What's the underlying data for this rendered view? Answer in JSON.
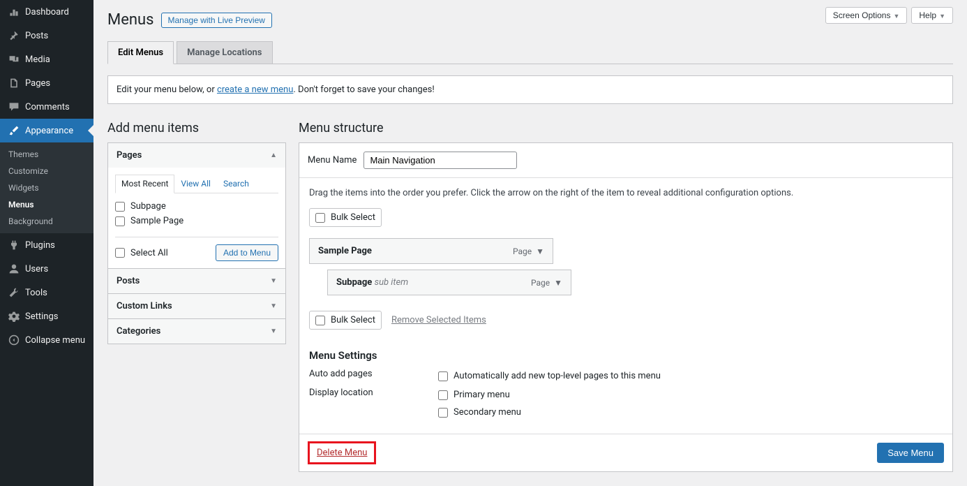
{
  "topbar": {
    "screen_options": "Screen Options",
    "help": "Help"
  },
  "page_title": "Menus",
  "manage_preview": "Manage with Live Preview",
  "sidebar": {
    "items": [
      {
        "label": "Dashboard"
      },
      {
        "label": "Posts"
      },
      {
        "label": "Media"
      },
      {
        "label": "Pages"
      },
      {
        "label": "Comments"
      },
      {
        "label": "Appearance"
      },
      {
        "label": "Plugins"
      },
      {
        "label": "Users"
      },
      {
        "label": "Tools"
      },
      {
        "label": "Settings"
      },
      {
        "label": "Collapse menu"
      }
    ],
    "sub": {
      "themes": "Themes",
      "customize": "Customize",
      "widgets": "Widgets",
      "menus": "Menus",
      "background": "Background"
    }
  },
  "tabs": {
    "edit": "Edit Menus",
    "locations": "Manage Locations"
  },
  "notice": {
    "pre": "Edit your menu below, or ",
    "link": "create a new menu",
    "post": ". Don't forget to save your changes!"
  },
  "add_items": {
    "heading": "Add menu items",
    "pages": "Pages",
    "posts": "Posts",
    "custom_links": "Custom Links",
    "categories": "Categories",
    "subtabs": {
      "recent": "Most Recent",
      "view_all": "View All",
      "search": "Search"
    },
    "items": {
      "subpage": "Subpage",
      "sample": "Sample Page"
    },
    "select_all": "Select All",
    "add_btn": "Add to Menu"
  },
  "structure": {
    "heading": "Menu structure",
    "menu_name_label": "Menu Name",
    "menu_name_value": "Main Navigation",
    "hint": "Drag the items into the order you prefer. Click the arrow on the right of the item to reveal additional configuration options.",
    "bulk_select": "Bulk Select",
    "remove_selected": "Remove Selected Items",
    "items": [
      {
        "title": "Sample Page",
        "type": "Page"
      },
      {
        "title": "Subpage",
        "sub": "sub item",
        "type": "Page"
      }
    ],
    "settings": {
      "heading": "Menu Settings",
      "auto_add_label": "Auto add pages",
      "auto_add_opt": "Automatically add new top-level pages to this menu",
      "display_label": "Display location",
      "primary": "Primary menu",
      "secondary": "Secondary menu"
    },
    "delete": "Delete Menu",
    "save": "Save Menu"
  }
}
